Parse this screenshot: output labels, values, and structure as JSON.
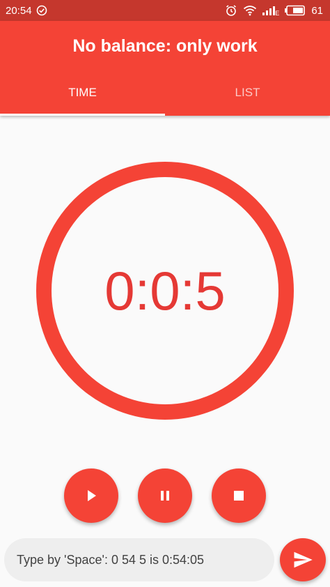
{
  "status_bar": {
    "time": "20:54",
    "battery_level": "61",
    "network_type": "E",
    "icons": [
      "check-circle-icon",
      "alarm-icon",
      "wifi-icon",
      "signal-icon",
      "battery-icon"
    ]
  },
  "app_bar": {
    "title": "No balance: only work"
  },
  "tabs": [
    {
      "label": "TIME",
      "active": true
    },
    {
      "label": "LIST",
      "active": false
    }
  ],
  "timer": {
    "display": "0:0:5"
  },
  "controls": {
    "icons": [
      "play-icon",
      "pause-icon",
      "stop-icon"
    ]
  },
  "input": {
    "placeholder": "Type by 'Space': 0 54 5 is 0:54:05"
  },
  "send": {
    "icon": "send-icon"
  },
  "colors": {
    "status_bar": "#C5372D",
    "primary": "#F44336",
    "timer_text": "#E53935",
    "background": "#FAFAFA",
    "input_background": "#EEEEEE"
  }
}
